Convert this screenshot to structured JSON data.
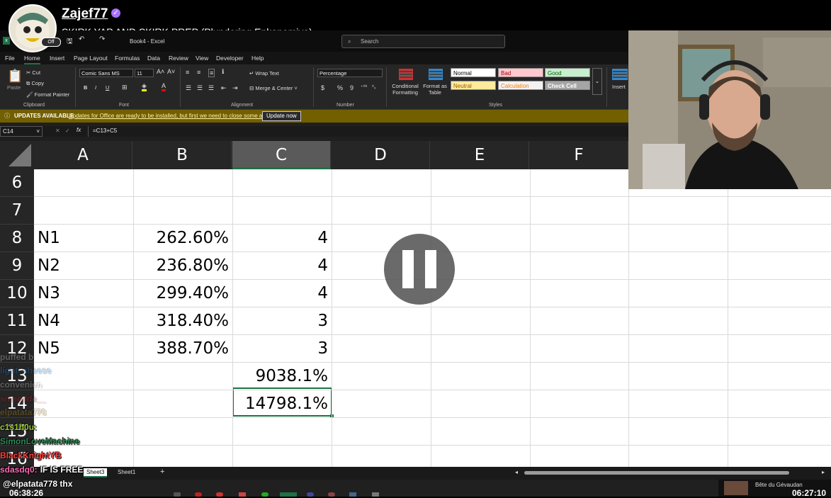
{
  "stream": {
    "streamer": "Zajef77",
    "title": "SKIRK YAP AND SKIRK PREP (Plundering Enkanomiya)",
    "avatar_badge": "Off"
  },
  "excel": {
    "doc_title": "Book4 - Excel",
    "search_placeholder": "Search",
    "menu": [
      "File",
      "Home",
      "Insert",
      "Page Layout",
      "Formulas",
      "Data",
      "Review",
      "View",
      "Developer",
      "Help"
    ],
    "ribbon": {
      "paste": "Paste",
      "cut": "Cut",
      "copy": "Copy",
      "format_painter": "Format Painter",
      "clipboard": "Clipboard",
      "font_name": "Comic Sans MS",
      "font_size": "11",
      "font": "Font",
      "bold": "B",
      "italic": "I",
      "underline": "U",
      "wrap_text": "Wrap Text",
      "merge_center": "Merge & Center",
      "alignment": "Alignment",
      "number_format": "Percentage",
      "number": "Number",
      "currency": "$",
      "percent": "%",
      "comma": "9",
      "conditional_formatting": "Conditional Formatting",
      "format_as_table": "Format as Table",
      "styles": "Styles",
      "style_cells": [
        {
          "label": "Normal",
          "bg": "#ffffff",
          "fg": "#000000"
        },
        {
          "label": "Bad",
          "bg": "#ffc7ce",
          "fg": "#9c0006"
        },
        {
          "label": "Good",
          "bg": "#c6efce",
          "fg": "#006100"
        },
        {
          "label": "Neutral",
          "bg": "#ffeb9c",
          "fg": "#9c5700"
        },
        {
          "label": "Calculation",
          "bg": "#f2f2f2",
          "fg": "#fa7d00"
        },
        {
          "label": "Check Cell",
          "bg": "#a5a5a5",
          "fg": "#ffffff"
        }
      ],
      "insert": "Insert"
    },
    "update": {
      "label": "UPDATES AVAILABLE",
      "message": "Updates for Office are ready to be installed, but first we need to close some apps.",
      "button": "Update now"
    },
    "name_box": "C14",
    "formula": "=C13+C5",
    "fx": "fx",
    "columns": [
      "A",
      "B",
      "C",
      "D",
      "E",
      "F"
    ],
    "rows": [
      {
        "num": "6",
        "a": "",
        "b": "",
        "c": ""
      },
      {
        "num": "7",
        "a": "",
        "b": "",
        "c": ""
      },
      {
        "num": "8",
        "a": "N1",
        "b": "262.60%",
        "c": "4"
      },
      {
        "num": "9",
        "a": "N2",
        "b": "236.80%",
        "c": "4"
      },
      {
        "num": "10",
        "a": "N3",
        "b": "299.40%",
        "c": "4"
      },
      {
        "num": "11",
        "a": "N4",
        "b": "318.40%",
        "c": "3"
      },
      {
        "num": "12",
        "a": "N5",
        "b": "388.70%",
        "c": "3"
      },
      {
        "num": "13",
        "a": "",
        "b": "",
        "c": "9038.1%"
      },
      {
        "num": "14",
        "a": "",
        "b": "",
        "c": "14798.1%"
      },
      {
        "num": "15",
        "a": "",
        "b": "",
        "c": ""
      },
      {
        "num": "16",
        "a": "",
        "b": "",
        "c": ""
      }
    ],
    "sheet_tabs": [
      "Sheet3",
      "Sheet1"
    ],
    "add_sheet": "+"
  },
  "chat": [
    {
      "user": "puffed b",
      "color": "#ffffff",
      "msg": "",
      "faded": true
    },
    {
      "user": "light_cheese",
      "color": "#1e90ff",
      "msg": "",
      "faded": true
    },
    {
      "user": "convenien",
      "color": "#ffffff",
      "msg": "",
      "faded": true
    },
    {
      "user": "smeedde__",
      "color": "#ff2020",
      "msg": "",
      "faded": true
    },
    {
      "user": "elpatata778",
      "color": "#daa520",
      "msg": "",
      "faded": true
    },
    {
      "user": "c1s1h0u:",
      "color": "#9acd32",
      "msg": "",
      "faded": false
    },
    {
      "user": "SimonLoveMachine",
      "color": "#2e8b57",
      "msg": "",
      "faded": false
    },
    {
      "user": "BlackKnightYB",
      "color": "#ff4040",
      "msg": "",
      "faded": false
    },
    {
      "user": "sdasdq0:",
      "color": "#ff69b4",
      "msg": "IF IS FREE",
      "faded": false
    },
    {
      "user": "",
      "color": "#ff69b4",
      "msg": "@elpatata778 thx",
      "faded": false
    }
  ],
  "taskbar": {
    "left_time": "06:38:26",
    "media_title": "Bête du Gévaudan",
    "right_time": "06:27:10"
  }
}
